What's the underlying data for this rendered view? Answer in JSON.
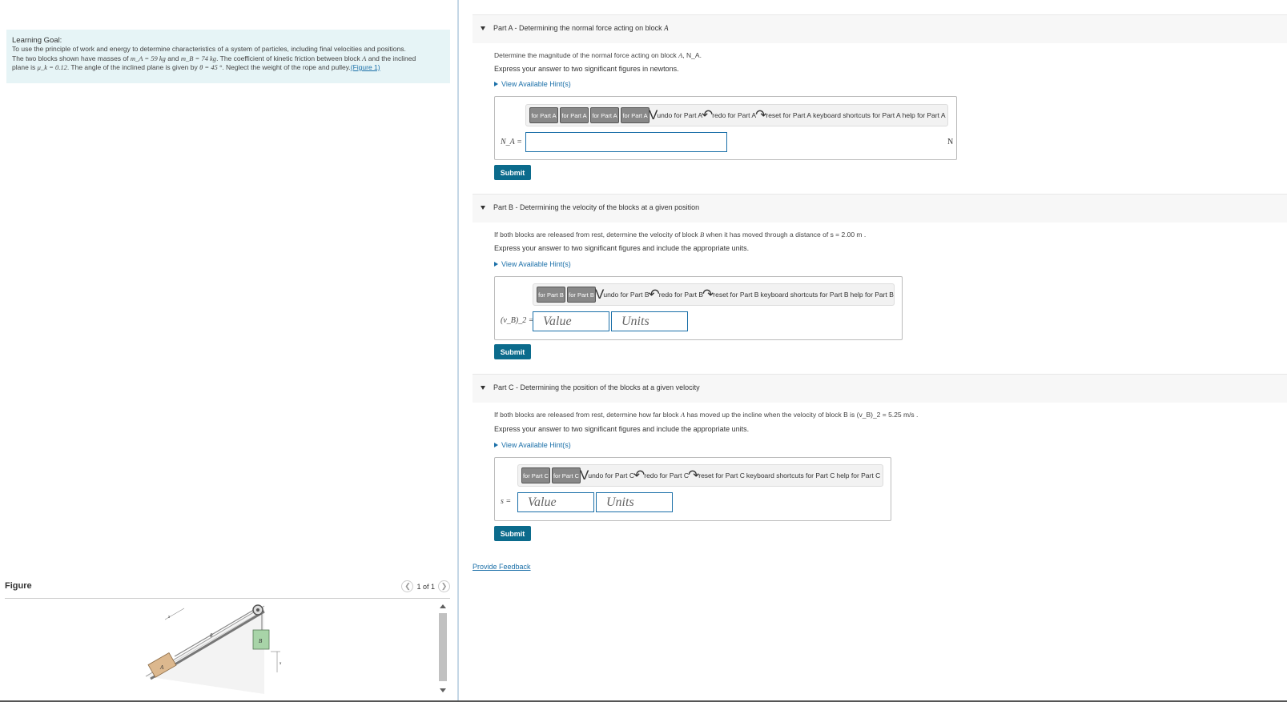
{
  "learning_goal": {
    "title": "Learning Goal:",
    "line1": "To use the principle of work and energy to determine characteristics of a system of particles, including final velocities and positions.",
    "line2_pre": "The two blocks shown have masses of ",
    "mA": "m_A = 59 kg",
    "and": " and ",
    "mB": "m_B = 74 kg",
    "line2_mid": ". The coefficient of kinetic friction between block ",
    "blockA": "A",
    "line2_post": " and the inclined",
    "line3_pre": "plane is ",
    "mu": "μ_k = 0.12",
    "line3_mid": ". The angle of the inclined plane is given by ",
    "theta": "θ = 45 °",
    "line3_post": ". Neglect the weight of the rope and pulley.",
    "figure_link": "(Figure 1)"
  },
  "figure": {
    "title": "Figure",
    "pager": "1 of 1",
    "labels": {
      "block_a": "A",
      "block_b": "B",
      "theta": "θ",
      "s": "s"
    }
  },
  "parts": [
    {
      "header_prefix": "Part A - Determining the normal force acting on block ",
      "header_italic": "A",
      "question_pre": "Determine the magnitude of the normal force acting on block ",
      "question_italic": "A",
      "question_post": ", N_A.",
      "express": "Express your answer to two significant figures in newtons.",
      "hint": "View Available Hint(s)",
      "toolbar": {
        "btns": [
          "for Part A",
          "for Part A",
          "for Part A",
          "for Part A"
        ],
        "undo": "undo for Part A",
        "redo": "redo for Part A",
        "reset": "reset for Part A",
        "keyboard": "keyboard shortcuts for Part A",
        "help": "help for Part A"
      },
      "var_label": "N_A =",
      "unit": "N",
      "submit": "Submit"
    },
    {
      "header_prefix": "Part B - Determining the velocity of the blocks at a given position",
      "question_pre": "If both blocks are released from rest, determine the velocity of block ",
      "question_italic": "B",
      "question_post": " when it has moved through a distance of s = 2.00 m .",
      "express": "Express your answer to two significant figures and include the appropriate units.",
      "hint": "View Available Hint(s)",
      "toolbar": {
        "btns": [
          "for Part B",
          "for Part B"
        ],
        "undo": "undo for Part B",
        "redo": "redo for Part B",
        "reset": "reset for Part B",
        "keyboard": "keyboard shortcuts for Part B",
        "help": "help for Part B"
      },
      "var_label": "(v_B)_2 =",
      "value_placeholder": "Value",
      "units_placeholder": "Units",
      "submit": "Submit"
    },
    {
      "header_prefix": "Part C - Determining the position of the blocks at a given velocity",
      "question_pre": "If both blocks are released from rest, determine how far block ",
      "question_italic": "A",
      "question_post": " has moved up the incline when the velocity of block B is (v_B)_2 = 5.25 m/s .",
      "express": "Express your answer to two significant figures and include the appropriate units.",
      "hint": "View Available Hint(s)",
      "toolbar": {
        "btns": [
          "for Part C",
          "for Part C"
        ],
        "undo": "undo for Part C",
        "redo": "redo for Part C",
        "reset": "reset for Part C",
        "keyboard": "keyboard shortcuts for Part C",
        "help": "help for Part C"
      },
      "var_label": "s =",
      "value_placeholder": "Value",
      "units_placeholder": "Units",
      "submit": "Submit"
    }
  ],
  "feedback": "Provide Feedback",
  "colors": {
    "accent": "#0b6b8c",
    "link": "#1a6fa8",
    "goal_bg": "#e6f4f6"
  }
}
